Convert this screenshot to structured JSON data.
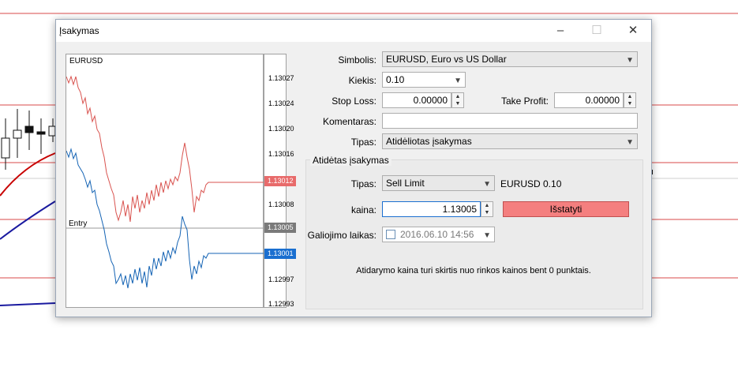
{
  "window": {
    "title": "Įsakymas",
    "minimize_glyph": "–",
    "maximize_glyph": "☐",
    "close_glyph": "✕"
  },
  "preview": {
    "symbol": "EURUSD",
    "entry_label": "Entry",
    "price_ticks": [
      "1.13027",
      "1.13024",
      "1.13020",
      "1.13016",
      "1.13008",
      "1.12997",
      "1.12993"
    ],
    "ask_tag": "1.13012",
    "entry_tag": "1.13005",
    "bid_tag": "1.13001",
    "colors": {
      "ask_line": "#d9534f",
      "bid_line": "#1463b4",
      "ask_tag": "#e86b6b",
      "entry_tag": "#7a7a7a",
      "bid_tag": "#1a6fd0"
    }
  },
  "form": {
    "symbol_label": "Simbolis:",
    "symbol_value": "EURUSD, Euro vs US Dollar",
    "volume_label": "Kiekis:",
    "volume_value": "0.10",
    "stoploss_label": "Stop Loss:",
    "stoploss_value": "0.00000",
    "takeprofit_label": "Take Profit:",
    "takeprofit_value": "0.00000",
    "comment_label": "Komentaras:",
    "comment_value": "",
    "type_label": "Tipas:",
    "type_value": "Atidėliotas įsakymas"
  },
  "pending": {
    "group_title": "Atidėtas įsakymas",
    "type_label": "Tipas:",
    "type_value": "Sell Limit",
    "summary": "EURUSD 0.10",
    "price_label": "kaina:",
    "price_value": "1.13005",
    "place_button": "Išstatyti",
    "expiry_label": "Galiojimo laikas:",
    "expiry_value": "2016.06.10 14:56",
    "note": "Atidarymo kaina turi skirtis nuo rinkos kainos bent 0 punktais."
  }
}
